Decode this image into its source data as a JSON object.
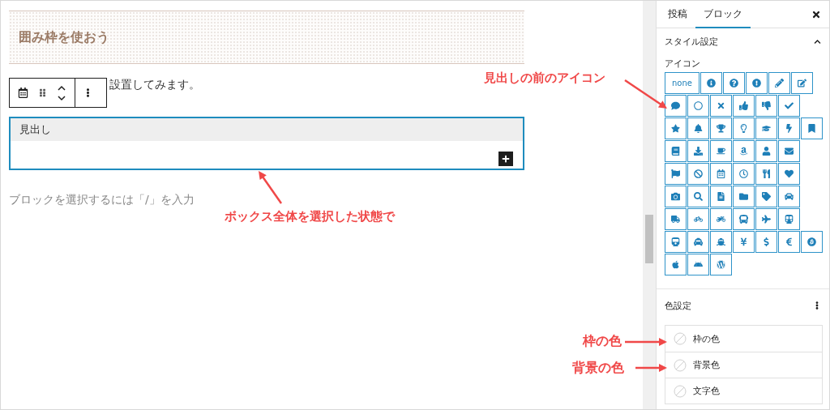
{
  "editor": {
    "heading": "囲み枠を使おう",
    "paragraph": "設置してみます。",
    "block": {
      "header": "見出し"
    },
    "placeholder": "ブロックを選択するには「/」を入力"
  },
  "sidebar": {
    "tabs": [
      {
        "label": "投稿",
        "selected": false
      },
      {
        "label": "ブロック",
        "selected": true
      }
    ],
    "style_panel": {
      "title": "スタイル設定",
      "expanded": true,
      "icon_label": "アイコン",
      "icon_rows": [
        [
          {
            "kind": "text",
            "label": "none"
          },
          {
            "kind": "icon"
          },
          {
            "kind": "icon"
          },
          {
            "kind": "icon"
          },
          {
            "kind": "icon"
          },
          {
            "kind": "icon"
          }
        ],
        [
          {
            "kind": "icon"
          },
          {
            "kind": "icon"
          },
          {
            "kind": "icon"
          },
          {
            "kind": "icon"
          },
          {
            "kind": "icon"
          },
          {
            "kind": "icon"
          }
        ],
        [
          {
            "kind": "icon"
          },
          {
            "kind": "icon"
          },
          {
            "kind": "icon"
          },
          {
            "kind": "icon"
          },
          {
            "kind": "icon"
          },
          {
            "kind": "icon"
          },
          {
            "kind": "icon"
          }
        ],
        [
          {
            "kind": "icon"
          },
          {
            "kind": "icon"
          },
          {
            "kind": "icon"
          },
          {
            "kind": "icon"
          },
          {
            "kind": "icon"
          },
          {
            "kind": "icon"
          }
        ],
        [
          {
            "kind": "icon"
          },
          {
            "kind": "icon"
          },
          {
            "kind": "icon"
          },
          {
            "kind": "icon"
          },
          {
            "kind": "icon"
          },
          {
            "kind": "icon"
          }
        ],
        [
          {
            "kind": "icon"
          },
          {
            "kind": "icon"
          },
          {
            "kind": "icon"
          },
          {
            "kind": "icon"
          },
          {
            "kind": "icon"
          },
          {
            "kind": "icon"
          }
        ],
        [
          {
            "kind": "icon"
          },
          {
            "kind": "icon"
          },
          {
            "kind": "icon"
          },
          {
            "kind": "icon"
          },
          {
            "kind": "icon"
          },
          {
            "kind": "icon"
          }
        ],
        [
          {
            "kind": "icon"
          },
          {
            "kind": "icon"
          },
          {
            "kind": "icon"
          },
          {
            "kind": "icon"
          },
          {
            "kind": "icon"
          },
          {
            "kind": "icon"
          },
          {
            "kind": "icon"
          }
        ],
        [
          {
            "kind": "icon"
          },
          {
            "kind": "icon"
          },
          {
            "kind": "icon"
          }
        ]
      ]
    },
    "color_panel": {
      "title": "色設定",
      "options": [
        {
          "label": "枠の色"
        },
        {
          "label": "背景色"
        },
        {
          "label": "文字色"
        }
      ]
    }
  },
  "annotations": [
    {
      "text": "見出しの前のアイコン"
    },
    {
      "text": "ボックス全体を選択した状態で"
    },
    {
      "text": "枠の色"
    },
    {
      "text": "背景の色"
    }
  ]
}
